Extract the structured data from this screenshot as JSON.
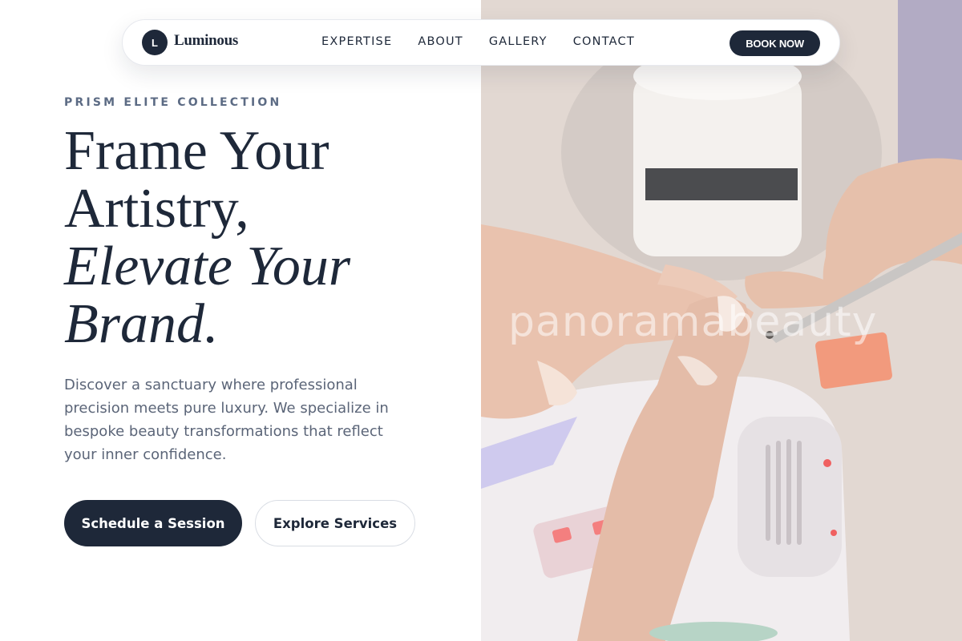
{
  "brand": {
    "initial": "L",
    "name": "Luminous"
  },
  "nav": {
    "links": [
      "EXPERTISE",
      "ABOUT",
      "GALLERY",
      "CONTACT"
    ],
    "cta_label": "BOOK NOW"
  },
  "hero": {
    "eyebrow": "PRISM ELITE COLLECTION",
    "headline": {
      "line1": "Frame Your",
      "line2": "Artistry,",
      "line3_italic": "Elevate Your",
      "line4_italic": "Brand."
    },
    "description": "Discover a sanctuary where professional precision meets pure luxury. We specialize in bespoke beauty transformations that reflect your inner confidence.",
    "primary_cta": "Schedule a Session",
    "secondary_cta": "Explore Services"
  },
  "image": {
    "watermark": "panoramabeauty",
    "subject": "manicure-photo"
  },
  "colors": {
    "navy": "#1e2839",
    "eyebrow": "#5c6b84",
    "body_text": "#5b6578",
    "white": "#ffffff"
  }
}
